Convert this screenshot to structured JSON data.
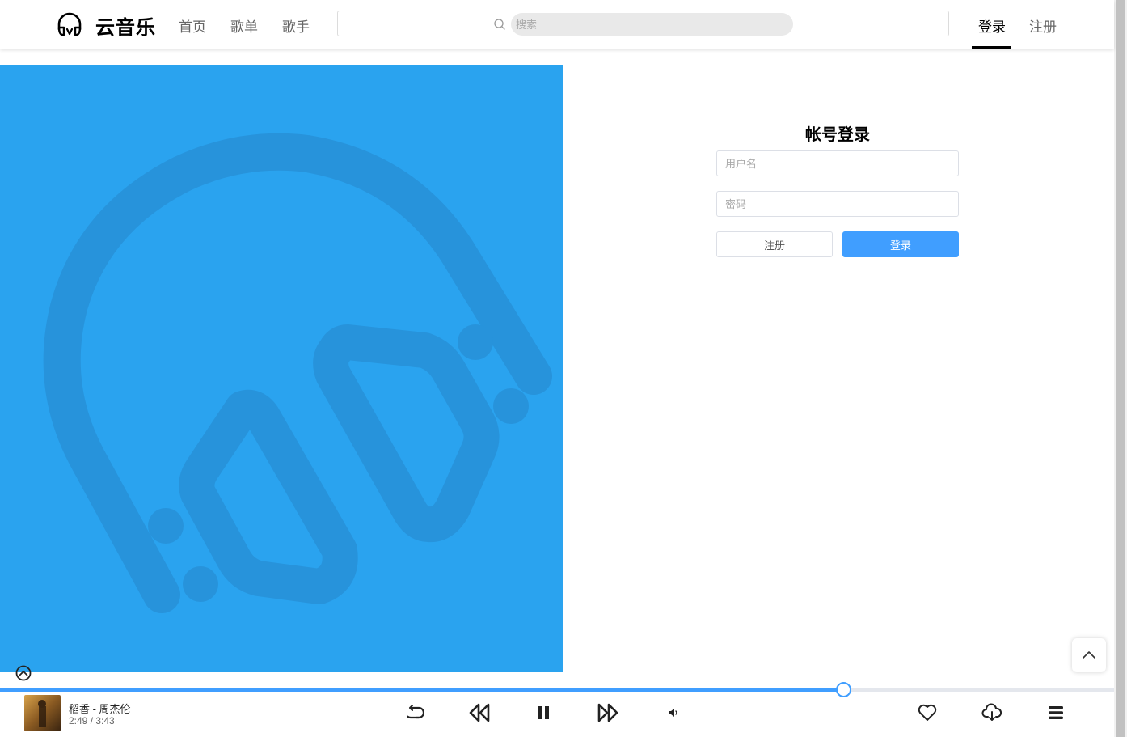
{
  "header": {
    "brand": "云音乐",
    "nav": [
      "首页",
      "歌单",
      "歌手"
    ],
    "search_placeholder": "搜索",
    "login_label": "登录",
    "register_label": "注册"
  },
  "login": {
    "title": "帐号登录",
    "username_placeholder": "用户名",
    "password_placeholder": "密码",
    "register_button": "注册",
    "login_button": "登录"
  },
  "player": {
    "song": "稻香 - 周杰伦",
    "time": "2:49 / 3:43",
    "progress_fraction": 0.757
  },
  "colors": {
    "accent": "#409eff",
    "banner": "#2aa3ef"
  },
  "icons": [
    "headphones-logo-icon",
    "search-icon",
    "chevron-up-icon",
    "repeat-icon",
    "previous-icon",
    "pause-icon",
    "next-icon",
    "volume-icon",
    "heart-icon",
    "cloud-download-icon",
    "menu-icon"
  ]
}
